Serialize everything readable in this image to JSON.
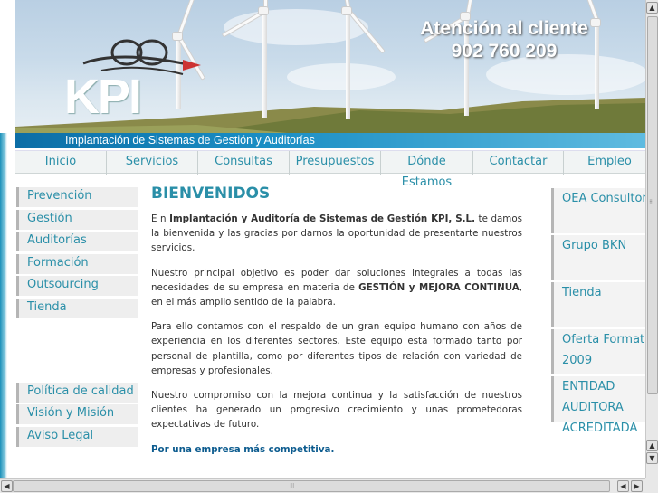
{
  "banner": {
    "attention_line1": "Atención al cliente",
    "attention_line2": "902 760 209",
    "logo_text": "KPI",
    "subtitle": "Implantación de Sistemas de Gestión y Auditorías"
  },
  "nav": [
    "Inicio",
    "Servicios",
    "Consultas",
    "Presupuestos",
    "Dónde Estamos",
    "Contactar",
    "Empleo"
  ],
  "left_menu_top": [
    "Prevención",
    "Gestión",
    "Auditorías",
    "Formación",
    "Outsourcing",
    "Tienda"
  ],
  "left_menu_bottom": [
    "Política de calidad",
    "Visión y Misión",
    "Aviso Legal"
  ],
  "content": {
    "title": "BIENVENIDOS",
    "p1_pre": "E n ",
    "p1_bold": "Implantación y Auditoría de Sistemas de Gestión KPI, S.L.",
    "p1_post": " te damos la bienvenida y las gracias por darnos la oportunidad de presentarte nuestros servicios.",
    "p2_pre": "Nuestro principal objetivo es poder dar soluciones integrales a todas las necesidades de su empresa en materia de ",
    "p2_bold": "GESTIÓN y MEJORA CONTINUA",
    "p2_post": ", en el más amplio sentido de la palabra.",
    "p3": "Para ello contamos con el respaldo de un gran equipo humano con años de experiencia en los diferentes sectores. Este equipo esta formado tanto por personal de plantilla, como por diferentes tipos de relación con variedad de empresas y profesionales.",
    "p4": "Nuestro compromiso con la mejora continua y la satisfacción de nuestros clientes ha generado un progresivo crecimiento y unas prometedoras expectativas de futuro.",
    "slogan": "Por una empresa más competitiva."
  },
  "right_menu": {
    "oea": "OEA Consultor",
    "bkn": "Grupo BKN",
    "tienda": "Tienda",
    "oferta1": "Oferta Formativa",
    "oferta2": "2009",
    "entidad1": "ENTIDAD",
    "entidad2": "AUDITORA",
    "entidad3": "ACREDITADA"
  },
  "colors": {
    "accent": "#2a8fa8",
    "banner_bar": "#1a8ec4",
    "slogan": "#0d5c8f"
  }
}
